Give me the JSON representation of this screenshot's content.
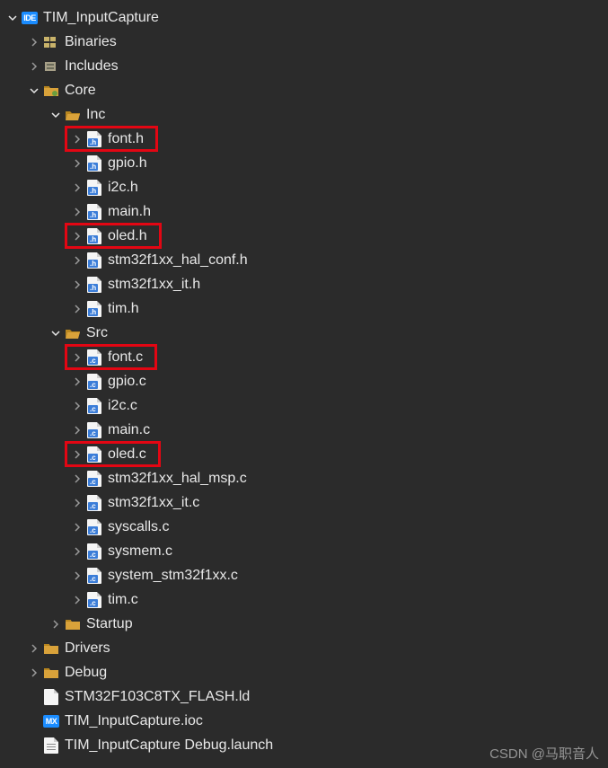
{
  "project": {
    "name": "TIM_InputCapture",
    "children": [
      {
        "label": "Binaries",
        "icon": "binaries",
        "expand": "right"
      },
      {
        "label": "Includes",
        "icon": "includes",
        "expand": "right"
      },
      {
        "label": "Core",
        "icon": "source-folder",
        "expand": "down",
        "children": [
          {
            "label": "Inc",
            "icon": "folder-open",
            "expand": "down",
            "children": [
              {
                "label": "font.h",
                "icon": "h",
                "expand": "right",
                "highlight": true
              },
              {
                "label": "gpio.h",
                "icon": "h",
                "expand": "right"
              },
              {
                "label": "i2c.h",
                "icon": "h",
                "expand": "right"
              },
              {
                "label": "main.h",
                "icon": "h",
                "expand": "right"
              },
              {
                "label": "oled.h",
                "icon": "h",
                "expand": "right",
                "highlight": true
              },
              {
                "label": "stm32f1xx_hal_conf.h",
                "icon": "h",
                "expand": "right"
              },
              {
                "label": "stm32f1xx_it.h",
                "icon": "h",
                "expand": "right"
              },
              {
                "label": "tim.h",
                "icon": "h",
                "expand": "right"
              }
            ]
          },
          {
            "label": "Src",
            "icon": "folder-open",
            "expand": "down",
            "children": [
              {
                "label": "font.c",
                "icon": "c",
                "expand": "right",
                "highlight": true
              },
              {
                "label": "gpio.c",
                "icon": "c",
                "expand": "right"
              },
              {
                "label": "i2c.c",
                "icon": "c",
                "expand": "right"
              },
              {
                "label": "main.c",
                "icon": "c",
                "expand": "right"
              },
              {
                "label": "oled.c",
                "icon": "c",
                "expand": "right",
                "highlight": true
              },
              {
                "label": "stm32f1xx_hal_msp.c",
                "icon": "c",
                "expand": "right"
              },
              {
                "label": "stm32f1xx_it.c",
                "icon": "c",
                "expand": "right"
              },
              {
                "label": "syscalls.c",
                "icon": "c",
                "expand": "right"
              },
              {
                "label": "sysmem.c",
                "icon": "c",
                "expand": "right"
              },
              {
                "label": "system_stm32f1xx.c",
                "icon": "c",
                "expand": "right"
              },
              {
                "label": "tim.c",
                "icon": "c",
                "expand": "right"
              }
            ]
          },
          {
            "label": "Startup",
            "icon": "folder",
            "expand": "right"
          }
        ]
      },
      {
        "label": "Drivers",
        "icon": "folder",
        "expand": "right"
      },
      {
        "label": "Debug",
        "icon": "folder",
        "expand": "right"
      },
      {
        "label": "STM32F103C8TX_FLASH.ld",
        "icon": "file",
        "expand": "none"
      },
      {
        "label": "TIM_InputCapture.ioc",
        "icon": "mx",
        "expand": "none"
      },
      {
        "label": "TIM_InputCapture Debug.launch",
        "icon": "txt",
        "expand": "none"
      }
    ]
  },
  "watermark": "CSDN @马职音人",
  "indent_unit": 24,
  "icons": {
    "chev_down_color": "#e8e8e8",
    "chev_right_color": "#9a9a9a",
    "folder_fill": "#d9a23a",
    "folder_open_fill": "#d9a23a"
  }
}
